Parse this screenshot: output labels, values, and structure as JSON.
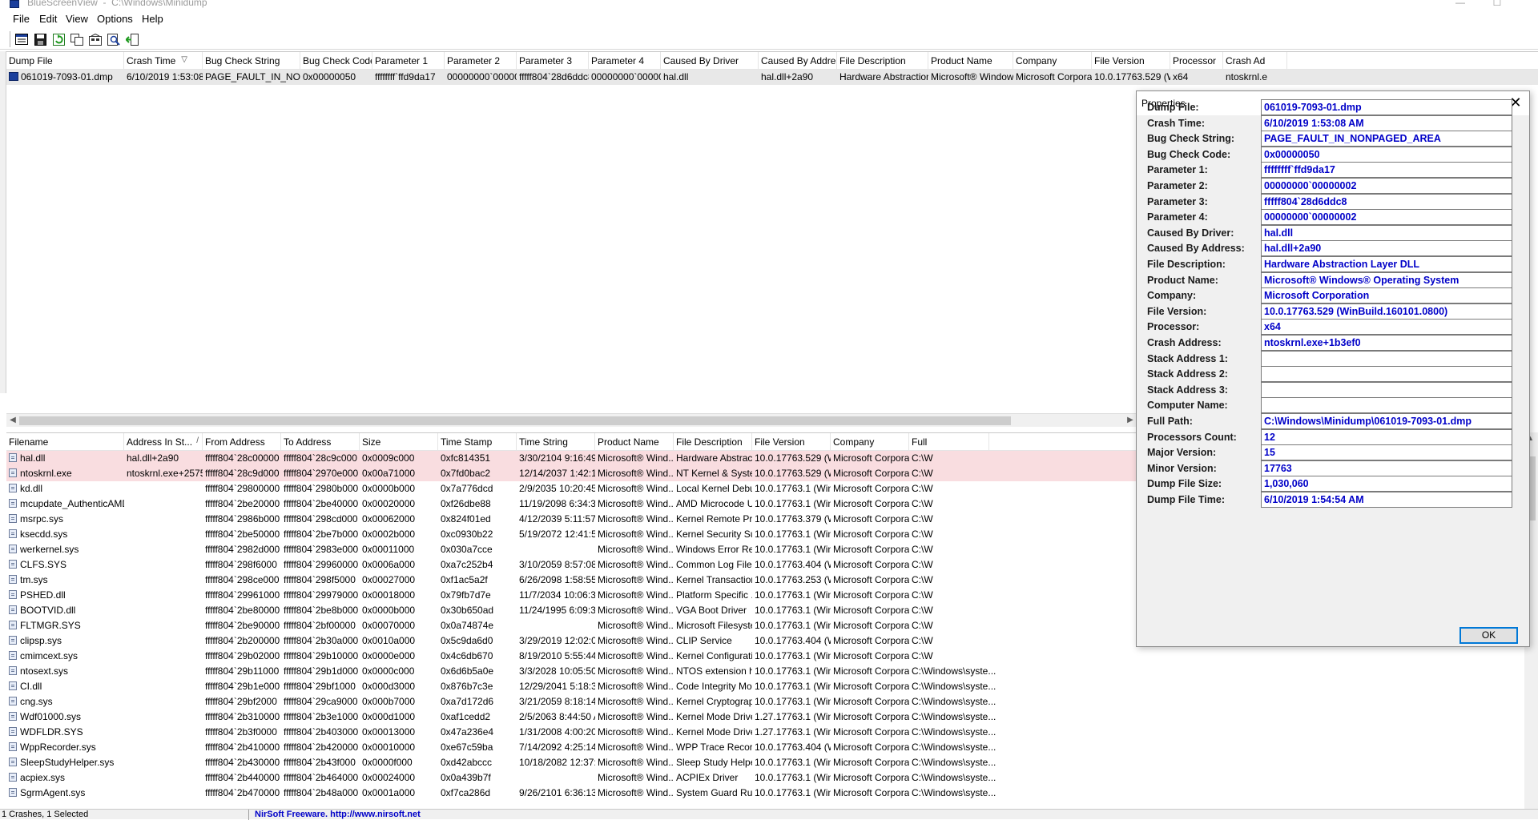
{
  "window": {
    "title": "BlueScreenView  -  C:\\Windows\\Minidump",
    "minimize_glyph": "—",
    "maximize_glyph": "☐"
  },
  "menu": [
    "File",
    "Edit",
    "View",
    "Options",
    "Help"
  ],
  "toolbar": {
    "icons": [
      "properties-icon",
      "save-icon",
      "refresh-icon",
      "copy-icon",
      "html-report-icon",
      "find-icon",
      "exit-icon"
    ]
  },
  "dump_list": {
    "columns": [
      "Dump File",
      "Crash Time",
      "Bug Check String",
      "Bug Check Code",
      "Parameter 1",
      "Parameter 2",
      "Parameter 3",
      "Parameter 4",
      "Caused By Driver",
      "Caused By Address",
      "File Description",
      "Product Name",
      "Company",
      "File Version",
      "Processor",
      "Crash Ad"
    ],
    "sort_indicator": "▽",
    "rows": [
      [
        "061019-7093-01.dmp",
        "6/10/2019 1:53:08 ...",
        "PAGE_FAULT_IN_NONPA...",
        "0x00000050",
        "ffffffff`ffd9da17",
        "00000000`000000...",
        "fffff804`28d6ddc8",
        "00000000`000000...",
        "hal.dll",
        "hal.dll+2a90",
        "Hardware Abstraction ...",
        "Microsoft® Window...",
        "Microsoft Corpora...",
        "10.0.17763.529 (Wi...",
        "x64",
        "ntoskrnl.e"
      ]
    ]
  },
  "module_list": {
    "columns": [
      "Filename",
      "Address In St...",
      "From Address",
      "To Address",
      "Size",
      "Time Stamp",
      "Time String",
      "Product Name",
      "File Description",
      "File Version",
      "Company",
      "Full"
    ],
    "sort_indicator": "/",
    "rows": [
      [
        "hal.dll",
        "hal.dll+2a90",
        "fffff804`28c00000",
        "fffff804`28c9c000",
        "0x0009c000",
        "0xfc814351",
        "3/30/2104 9:16:49 ...",
        "Microsoft® Wind...",
        "Hardware Abstract...",
        "10.0.17763.529 (Wi...",
        "Microsoft Corpora...",
        "C:\\W"
      ],
      [
        "ntoskrnl.exe",
        "ntoskrnl.exe+2575...",
        "fffff804`28c9d000",
        "fffff804`2970e000",
        "0x00a71000",
        "0x7fd0bac2",
        "12/14/2037 1:42:10...",
        "Microsoft® Wind...",
        "NT Kernel & System",
        "10.0.17763.529 (Wi...",
        "Microsoft Corpora...",
        "C:\\W"
      ],
      [
        "kd.dll",
        "",
        "fffff804`29800000",
        "fffff804`2980b000",
        "0x0000b000",
        "0x7a776dcd",
        "2/9/2035 10:20:45 ...",
        "Microsoft® Wind...",
        "Local Kernel Debu...",
        "10.0.17763.1 (WinB...",
        "Microsoft Corpora...",
        "C:\\W"
      ],
      [
        "mcupdate_AuthenticAMD.dll",
        "",
        "fffff804`2be20000",
        "fffff804`2be40000",
        "0x00020000",
        "0xf26dbe88",
        "11/19/2098 6:34:32...",
        "Microsoft® Wind...",
        "AMD Microcode U...",
        "10.0.17763.1 (WinB...",
        "Microsoft Corpora...",
        "C:\\W"
      ],
      [
        "msrpc.sys",
        "",
        "fffff804`2986b000",
        "fffff804`298cd000",
        "0x00062000",
        "0x824f01ed",
        "4/12/2039 5:11:57 ...",
        "Microsoft® Wind...",
        "Kernel Remote Pro...",
        "10.0.17763.379 (Wi...",
        "Microsoft Corpora...",
        "C:\\W"
      ],
      [
        "ksecdd.sys",
        "",
        "fffff804`2be50000",
        "fffff804`2be7b000",
        "0x0002b000",
        "0xc0930b22",
        "5/19/2072 12:41:54...",
        "Microsoft® Wind...",
        "Kernel Security Su...",
        "10.0.17763.1 (WinB...",
        "Microsoft Corpora...",
        "C:\\W"
      ],
      [
        "werkernel.sys",
        "",
        "fffff804`2982d000",
        "fffff804`2983e000",
        "0x00011000",
        "0x030a7cce",
        "",
        "Microsoft® Wind...",
        "Windows Error Re...",
        "10.0.17763.1 (WinB...",
        "Microsoft Corpora...",
        "C:\\W"
      ],
      [
        "CLFS.SYS",
        "",
        "fffff804`298f6000",
        "fffff804`29960000",
        "0x0006a000",
        "0xa7c252b4",
        "3/10/2059 8:57:08 ...",
        "Microsoft® Wind...",
        "Common Log File ...",
        "10.0.17763.404 (Wi...",
        "Microsoft Corpora...",
        "C:\\W"
      ],
      [
        "tm.sys",
        "",
        "fffff804`298ce000",
        "fffff804`298f5000",
        "0x00027000",
        "0xf1ac5a2f",
        "6/26/2098 1:58:55 ...",
        "Microsoft® Wind...",
        "Kernel Transaction...",
        "10.0.17763.253 (Wi...",
        "Microsoft Corpora...",
        "C:\\W"
      ],
      [
        "PSHED.dll",
        "",
        "fffff804`29961000",
        "fffff804`29979000",
        "0x00018000",
        "0x79fb7d7e",
        "11/7/2034 10:06:38...",
        "Microsoft® Wind...",
        "Platform Specific ...",
        "10.0.17763.1 (WinB...",
        "Microsoft Corpora...",
        "C:\\W"
      ],
      [
        "BOOTVID.dll",
        "",
        "fffff804`2be80000",
        "fffff804`2be8b000",
        "0x0000b000",
        "0x30b650ad",
        "11/24/1995 6:09:33...",
        "Microsoft® Wind...",
        "VGA Boot Driver",
        "10.0.17763.1 (WinB...",
        "Microsoft Corpora...",
        "C:\\W"
      ],
      [
        "FLTMGR.SYS",
        "",
        "fffff804`2be90000",
        "fffff804`2bf00000",
        "0x00070000",
        "0x0a74874e",
        "",
        "Microsoft® Wind...",
        "Microsoft Filesyste...",
        "10.0.17763.1 (WinB...",
        "Microsoft Corpora...",
        "C:\\W"
      ],
      [
        "clipsp.sys",
        "",
        "fffff804`2b200000",
        "fffff804`2b30a000",
        "0x0010a000",
        "0x5c9da6d0",
        "3/29/2019 12:02:08...",
        "Microsoft® Wind...",
        "CLIP Service",
        "10.0.17763.404 (Wi...",
        "Microsoft Corpora...",
        "C:\\W"
      ],
      [
        "cmimcext.sys",
        "",
        "fffff804`29b02000",
        "fffff804`29b10000",
        "0x0000e000",
        "0x4c6db670",
        "8/19/2010 5:55:44 ...",
        "Microsoft® Wind...",
        "Kernel Configurati...",
        "10.0.17763.1 (WinB...",
        "Microsoft Corpora...",
        "C:\\W"
      ],
      [
        "ntosext.sys",
        "",
        "fffff804`29b11000",
        "fffff804`29b1d000",
        "0x0000c000",
        "0x6d6b5a0e",
        "3/3/2028 10:05:50 ...",
        "Microsoft® Wind...",
        "NTOS extension h...",
        "10.0.17763.1 (WinB...",
        "Microsoft Corpora...",
        "C:\\Windows\\syste..."
      ],
      [
        "CI.dll",
        "",
        "fffff804`29b1e000",
        "fffff804`29bf1000",
        "0x000d3000",
        "0x876b7c3e",
        "12/29/2041 5:18:38...",
        "Microsoft® Wind...",
        "Code Integrity Mo...",
        "10.0.17763.1 (WinB...",
        "Microsoft Corpora...",
        "C:\\Windows\\syste..."
      ],
      [
        "cng.sys",
        "",
        "fffff804`29bf2000",
        "fffff804`29ca9000",
        "0x000b7000",
        "0xa7d172d6",
        "3/21/2059 8:18:14 ...",
        "Microsoft® Wind...",
        "Kernel Cryptograp...",
        "10.0.17763.1 (WinB...",
        "Microsoft Corpora...",
        "C:\\Windows\\syste..."
      ],
      [
        "Wdf01000.sys",
        "",
        "fffff804`2b310000",
        "fffff804`2b3e1000",
        "0x000d1000",
        "0xaf1cedd2",
        "2/5/2063 8:44:50 AM",
        "Microsoft® Wind...",
        "Kernel Mode Drive...",
        "1.27.17763.1 (WinB...",
        "Microsoft Corpora...",
        "C:\\Windows\\syste..."
      ],
      [
        "WDFLDR.SYS",
        "",
        "fffff804`2b3f0000",
        "fffff804`2b403000",
        "0x00013000",
        "0x47a236e4",
        "1/31/2008 4:00:20 ...",
        "Microsoft® Wind...",
        "Kernel Mode Drive...",
        "1.27.17763.1 (WinB...",
        "Microsoft Corpora...",
        "C:\\Windows\\syste..."
      ],
      [
        "WppRecorder.sys",
        "",
        "fffff804`2b410000",
        "fffff804`2b420000",
        "0x00010000",
        "0xe67c59ba",
        "7/14/2092 4:25:14 ...",
        "Microsoft® Wind...",
        "WPP Trace Recorder",
        "10.0.17763.404 (Wi...",
        "Microsoft Corpora...",
        "C:\\Windows\\syste..."
      ],
      [
        "SleepStudyHelper.sys",
        "",
        "fffff804`2b430000",
        "fffff804`2b43f000",
        "0x0000f000",
        "0xd42abccc",
        "10/18/2082 12:37:1...",
        "Microsoft® Wind...",
        "Sleep Study Helper",
        "10.0.17763.1 (WinB...",
        "Microsoft Corpora...",
        "C:\\Windows\\syste..."
      ],
      [
        "acpiex.sys",
        "",
        "fffff804`2b440000",
        "fffff804`2b464000",
        "0x00024000",
        "0x0a439b7f",
        "",
        "Microsoft® Wind...",
        "ACPIEx Driver",
        "10.0.17763.1 (WinB...",
        "Microsoft Corpora...",
        "C:\\Windows\\syste..."
      ],
      [
        "SgrmAgent.sys",
        "",
        "fffff804`2b470000",
        "fffff804`2b48a000",
        "0x0001a000",
        "0xf7ca286d",
        "9/26/2101 6:36:13 ...",
        "Microsoft® Wind...",
        "System Guard Run...",
        "10.0.17763.1 (WinB...",
        "Microsoft Corpora...",
        "C:\\Windows\\syste..."
      ]
    ]
  },
  "properties": {
    "title": "Properties",
    "close_glyph": "✕",
    "fields": [
      {
        "label": "Dump File:",
        "value": "061019-7093-01.dmp"
      },
      {
        "label": "Crash Time:",
        "value": "6/10/2019 1:53:08 AM"
      },
      {
        "label": "Bug Check String:",
        "value": "PAGE_FAULT_IN_NONPAGED_AREA"
      },
      {
        "label": "Bug Check Code:",
        "value": "0x00000050"
      },
      {
        "label": "Parameter 1:",
        "value": "ffffffff`ffd9da17"
      },
      {
        "label": "Parameter 2:",
        "value": "00000000`00000002"
      },
      {
        "label": "Parameter 3:",
        "value": "fffff804`28d6ddc8"
      },
      {
        "label": "Parameter 4:",
        "value": "00000000`00000002"
      },
      {
        "label": "Caused By Driver:",
        "value": "hal.dll"
      },
      {
        "label": "Caused By Address:",
        "value": "hal.dll+2a90"
      },
      {
        "label": "File Description:",
        "value": "Hardware Abstraction Layer DLL"
      },
      {
        "label": "Product Name:",
        "value": "Microsoft® Windows® Operating System"
      },
      {
        "label": "Company:",
        "value": "Microsoft Corporation"
      },
      {
        "label": "File Version:",
        "value": "10.0.17763.529 (WinBuild.160101.0800)"
      },
      {
        "label": "Processor:",
        "value": "x64"
      },
      {
        "label": "Crash Address:",
        "value": "ntoskrnl.exe+1b3ef0"
      },
      {
        "label": "Stack Address 1:",
        "value": ""
      },
      {
        "label": "Stack Address 2:",
        "value": ""
      },
      {
        "label": "Stack Address 3:",
        "value": ""
      },
      {
        "label": "Computer Name:",
        "value": ""
      },
      {
        "label": "Full Path:",
        "value": "C:\\Windows\\Minidump\\061019-7093-01.dmp"
      },
      {
        "label": "Processors Count:",
        "value": "12"
      },
      {
        "label": "Major Version:",
        "value": "15"
      },
      {
        "label": "Minor Version:",
        "value": "17763"
      },
      {
        "label": "Dump File Size:",
        "value": "1,030,060"
      },
      {
        "label": "Dump File Time:",
        "value": "6/10/2019 1:54:54 AM"
      }
    ],
    "ok_label": "OK"
  },
  "status": {
    "left": "1 Crashes, 1 Selected",
    "right": "NirSoft Freeware.  http://www.nirsoft.net"
  },
  "colors": {
    "value_text": "#0000c8",
    "highlight_row": "#f9dde0"
  }
}
